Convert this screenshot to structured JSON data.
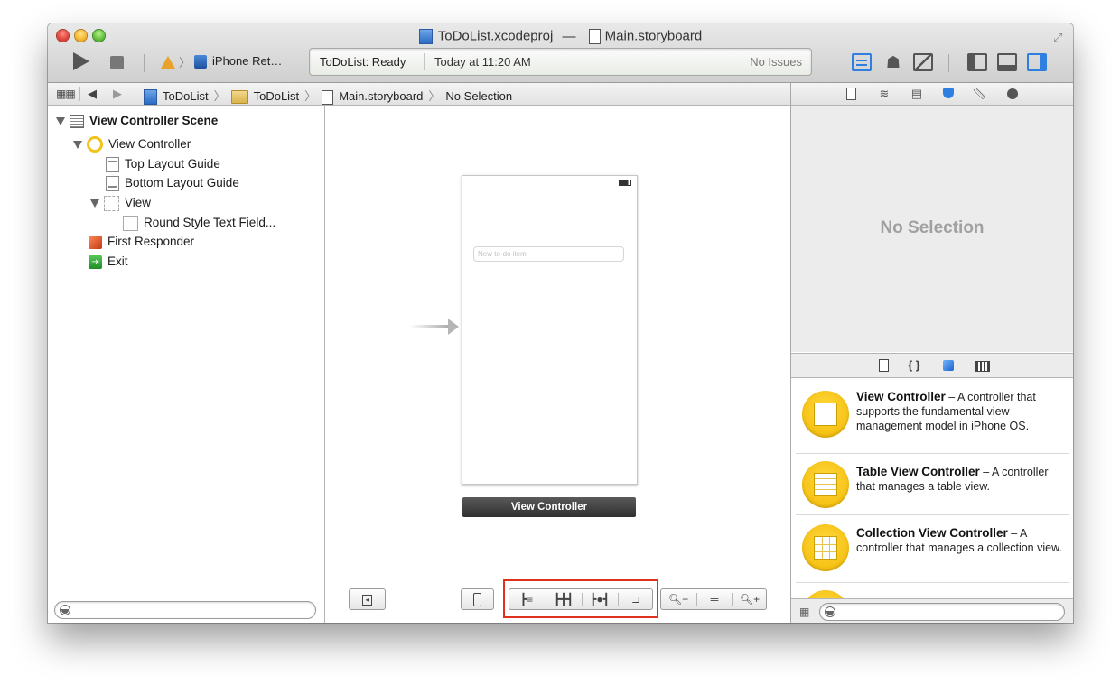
{
  "window": {
    "project_name": "ToDoList.xcodeproj",
    "title_separator": "—",
    "file_name": "Main.storyboard"
  },
  "toolbar": {
    "scheme_target": "iPhone Ret…",
    "activity_status": "ToDoList: Ready",
    "activity_time": "Today at 11:20 AM",
    "activity_issues": "No Issues"
  },
  "jumpbar": {
    "path": [
      "ToDoList",
      "ToDoList",
      "Main.storyboard",
      "No Selection"
    ]
  },
  "outline": {
    "scene": "View Controller Scene",
    "view_controller": "View Controller",
    "top_layout_guide": "Top Layout Guide",
    "bottom_layout_guide": "Bottom Layout Guide",
    "view": "View",
    "text_field": "Round Style Text Field...",
    "first_responder": "First Responder",
    "exit": "Exit"
  },
  "canvas": {
    "text_field_placeholder": "New to-do item",
    "scene_label": "View Controller"
  },
  "inspector": {
    "empty_state": "No Selection"
  },
  "library": {
    "items": [
      {
        "title": "View Controller",
        "description": " – A controller that supports the fundamental view-management model in iPhone OS."
      },
      {
        "title": "Table View Controller",
        "description": " – A controller that manages a table view."
      },
      {
        "title": "Collection View Controller",
        "description": " – A controller that manages a collection view."
      }
    ]
  },
  "colors": {
    "accent": "#2f7fe0",
    "highlight_box": "#e0301e",
    "library_icon": "#f2b800"
  }
}
